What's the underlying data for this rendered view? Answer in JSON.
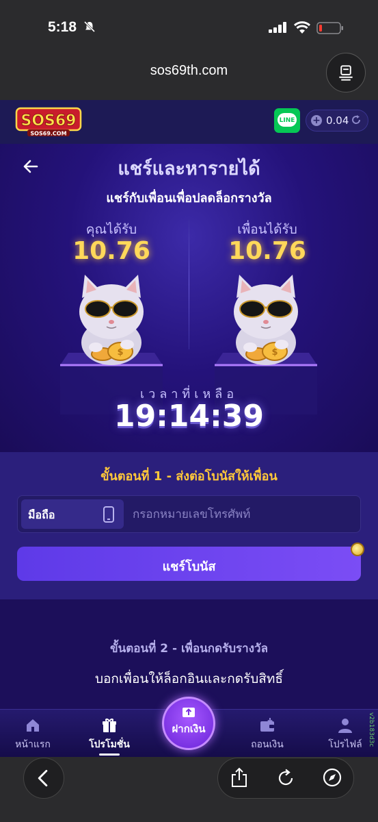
{
  "status_bar": {
    "time": "5:18"
  },
  "browser": {
    "url": "sos69th.com"
  },
  "header": {
    "logo_text": "SOS69",
    "logo_subtext": "SOS69.COM",
    "line_label": "LINE",
    "balance": "0.04"
  },
  "hero": {
    "title": "แชร์และหารายได้",
    "subtitle": "แชร์กับเพื่อนเพื่อปลดล็อกรางวัล",
    "you_receive_label": "คุณได้รับ",
    "you_receive_value": "10.76",
    "friend_receive_label": "เพื่อนได้รับ",
    "friend_receive_value": "10.76",
    "timer_label": "เวลาที่เหลือ",
    "timer_value": "19:14:39"
  },
  "step1": {
    "title": "ขั้นตอนที่ 1 - ส่งต่อโบนัสให้เพื่อน",
    "phone_label": "มือถือ",
    "phone_placeholder": "กรอกหมายเลขโทรศัพท์",
    "share_button": "แชร์โบนัส"
  },
  "step2": {
    "title": "ขั้นตอนที่ 2 - เพื่อนกดรับรางวัล",
    "description": "บอกเพื่อนให้ล็อกอินและกดรับสิทธิ์"
  },
  "bottom_nav": {
    "home": "หน้าแรก",
    "promotions": "โปรโมชั่น",
    "deposit": "ฝากเงิน",
    "withdraw": "ถอนเงิน",
    "profile": "โปรไฟล์",
    "active": "promotions",
    "version": "v2b183d3c"
  },
  "colors": {
    "brand_purple": "#24127a",
    "accent_gold": "#ffc83a",
    "button_purple": "#6a42ee",
    "line_green": "#06c755"
  }
}
